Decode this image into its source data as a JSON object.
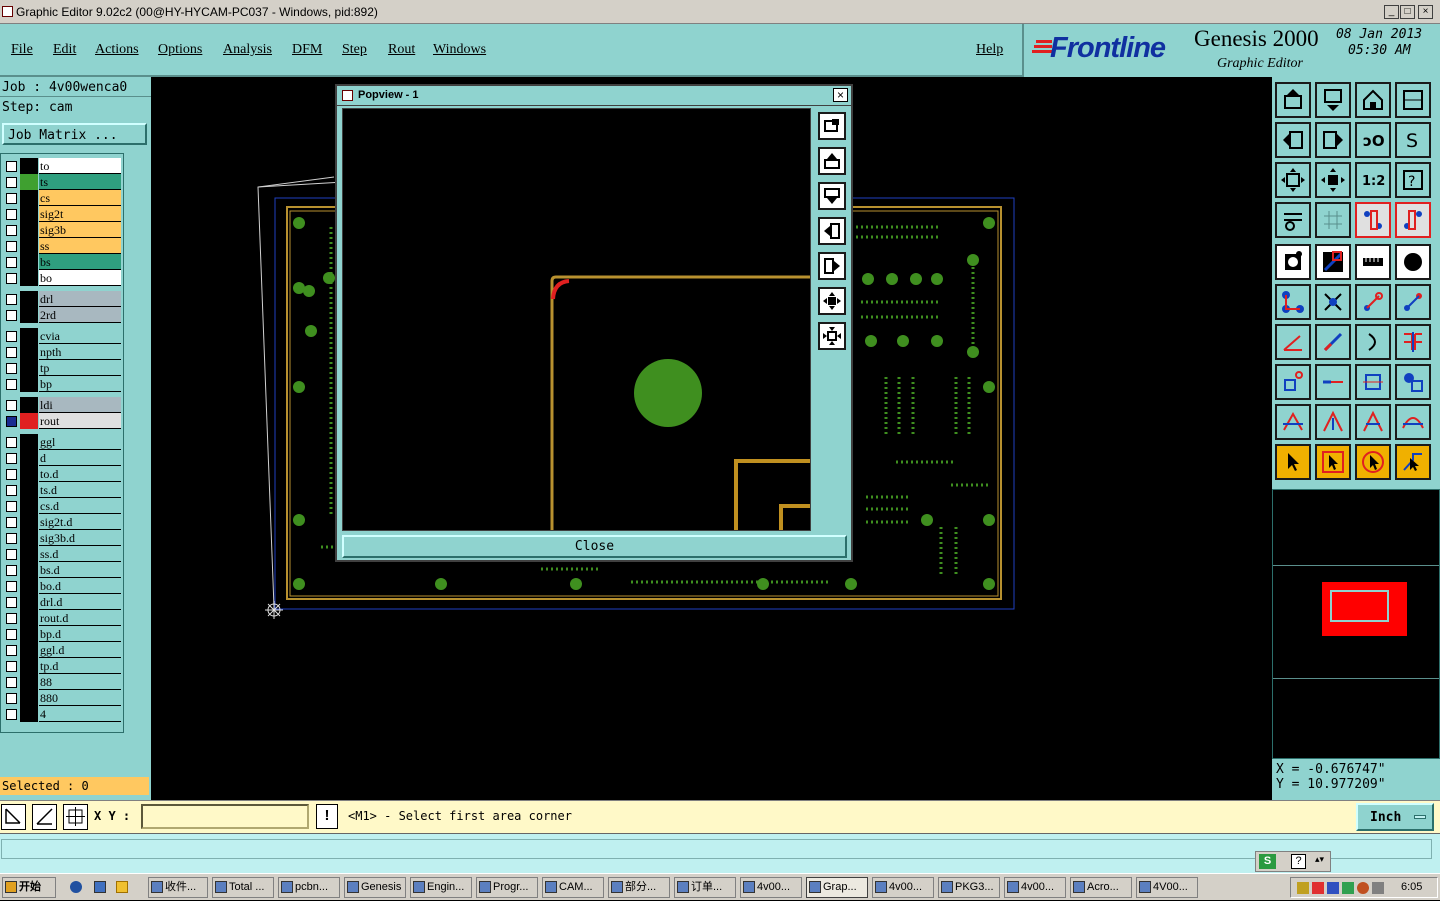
{
  "window": {
    "title": "Graphic Editor 9.02c2 (00@HY-HYCAM-PC037 - Windows, pid:892)"
  },
  "menu": {
    "items": [
      "File",
      "Edit",
      "Actions",
      "Options",
      "Analysis",
      "DFM",
      "Step",
      "Rout",
      "Windows"
    ],
    "help": "Help"
  },
  "brand": {
    "logo": "Frontline",
    "product": "Genesis 2000",
    "subtitle": "Graphic Editor",
    "date": "08 Jan 2013",
    "time": "05:30 AM"
  },
  "job": {
    "job_line": "Job : 4v00wenca0",
    "step_line": "Step: cam",
    "matrix_button": "Job Matrix ..."
  },
  "layers": [
    {
      "name": "to",
      "color": "#ffffff",
      "swatch": "#000000"
    },
    {
      "name": "ts",
      "color": "#2f9f7f",
      "swatch": "#3fa030"
    },
    {
      "name": "cs",
      "color": "#ffc860",
      "swatch": "#000000"
    },
    {
      "name": "sig2t",
      "color": "#ffc860",
      "swatch": "#000000"
    },
    {
      "name": "sig3b",
      "color": "#ffc860",
      "swatch": "#000000"
    },
    {
      "name": "ss",
      "color": "#ffc860",
      "swatch": "#000000"
    },
    {
      "name": "bs",
      "color": "#2f9f7f",
      "swatch": "#000000"
    },
    {
      "name": "bo",
      "color": "#ffffff",
      "swatch": "#000000"
    },
    {
      "name": "drl",
      "color": "#a8b8c0",
      "swatch": "#000000"
    },
    {
      "name": "2rd",
      "color": "#a8b8c0",
      "swatch": "#000000"
    },
    {
      "name": "cvia",
      "color": "#8fd3cf",
      "swatch": "#000000"
    },
    {
      "name": "npth",
      "color": "#8fd3cf",
      "swatch": "#000000"
    },
    {
      "name": "tp",
      "color": "#8fd3cf",
      "swatch": "#000000"
    },
    {
      "name": "bp",
      "color": "#8fd3cf",
      "swatch": "#000000"
    },
    {
      "name": "ldi",
      "color": "#a8b8c0",
      "swatch": "#000000"
    },
    {
      "name": "rout",
      "color": "#e0e0e0",
      "swatch": "#e02020"
    },
    {
      "name": "ggl",
      "color": "#8fd3cf",
      "swatch": "#000000"
    },
    {
      "name": "d",
      "color": "#8fd3cf",
      "swatch": "#000000"
    },
    {
      "name": "to.d",
      "color": "#8fd3cf",
      "swatch": "#000000"
    },
    {
      "name": "ts.d",
      "color": "#8fd3cf",
      "swatch": "#000000"
    },
    {
      "name": "cs.d",
      "color": "#8fd3cf",
      "swatch": "#000000"
    },
    {
      "name": "sig2t.d",
      "color": "#8fd3cf",
      "swatch": "#000000"
    },
    {
      "name": "sig3b.d",
      "color": "#8fd3cf",
      "swatch": "#000000"
    },
    {
      "name": "ss.d",
      "color": "#8fd3cf",
      "swatch": "#000000"
    },
    {
      "name": "bs.d",
      "color": "#8fd3cf",
      "swatch": "#000000"
    },
    {
      "name": "bo.d",
      "color": "#8fd3cf",
      "swatch": "#000000"
    },
    {
      "name": "drl.d",
      "color": "#8fd3cf",
      "swatch": "#000000"
    },
    {
      "name": "rout.d",
      "color": "#8fd3cf",
      "swatch": "#000000"
    },
    {
      "name": "bp.d",
      "color": "#8fd3cf",
      "swatch": "#000000"
    },
    {
      "name": "ggl.d",
      "color": "#8fd3cf",
      "swatch": "#000000"
    },
    {
      "name": "tp.d",
      "color": "#8fd3cf",
      "swatch": "#000000"
    },
    {
      "name": "88",
      "color": "#8fd3cf",
      "swatch": "#000000"
    },
    {
      "name": "880",
      "color": "#8fd3cf",
      "swatch": "#000000"
    },
    {
      "name": "4",
      "color": "#8fd3cf",
      "swatch": "#000000"
    }
  ],
  "selected": "Selected : 0",
  "popup": {
    "title": "Popview - 1",
    "close_label": "Close"
  },
  "coords": {
    "x": "X =  -0.676747\"",
    "y": "Y =  10.977209\""
  },
  "status": {
    "xy_label": "X Y :",
    "xy_value": "",
    "prompt": "<M1> - Select first area corner",
    "units": "Inch"
  },
  "taskbar": {
    "start": "开始",
    "tasks": [
      "收件...",
      "Total ...",
      "pcbn...",
      "Genesis",
      "Engin...",
      "Progr...",
      "CAM...",
      "部分...",
      "订单...",
      "4v00...",
      "Grap...",
      "4v00...",
      "PKG3...",
      "4v00...",
      "Acro...",
      "4V00..."
    ],
    "clock": "6:05"
  },
  "colors": {
    "panel": "#8fd3cf",
    "copper": "#3f8f1f",
    "outline": "#b8912f",
    "highlight": "#e02020"
  }
}
